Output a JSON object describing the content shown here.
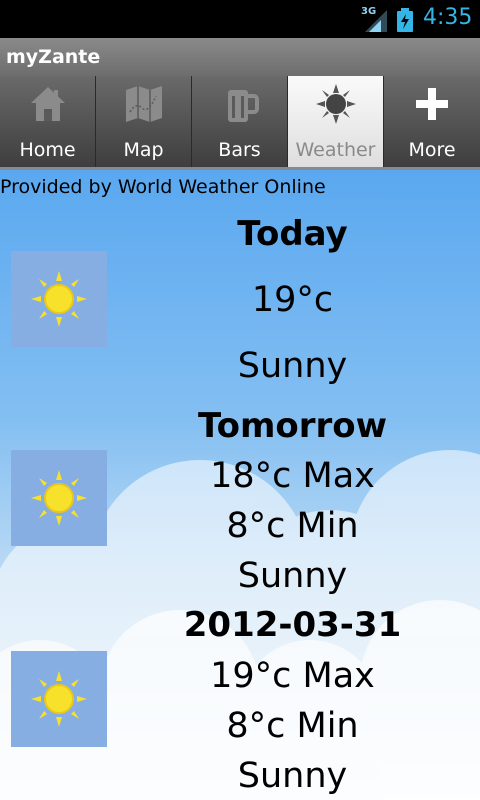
{
  "status": {
    "network": "3G",
    "time": "4:35"
  },
  "app": {
    "title": "myZante"
  },
  "tabs": [
    {
      "label": "Home",
      "icon": "home-icon"
    },
    {
      "label": "Map",
      "icon": "map-icon"
    },
    {
      "label": "Bars",
      "icon": "beer-mug-icon"
    },
    {
      "label": "Weather",
      "icon": "sun-icon",
      "active": true
    },
    {
      "label": "More",
      "icon": "plus-icon"
    }
  ],
  "provider": "Provided by World Weather Online",
  "forecast": [
    {
      "day": "Today",
      "temp": "19°c",
      "condition": "Sunny"
    },
    {
      "day": "Tomorrow",
      "max": "18°c Max",
      "min": "8°c Min",
      "condition": "Sunny"
    },
    {
      "day": "2012-03-31",
      "max": "19°c Max",
      "min": "8°c Min",
      "condition": "Sunny"
    }
  ],
  "colors": {
    "accent": "#35b5e6",
    "sky": "#5aa8f0",
    "icon_bg": "#86aee3",
    "sun": "#f7e12a"
  }
}
